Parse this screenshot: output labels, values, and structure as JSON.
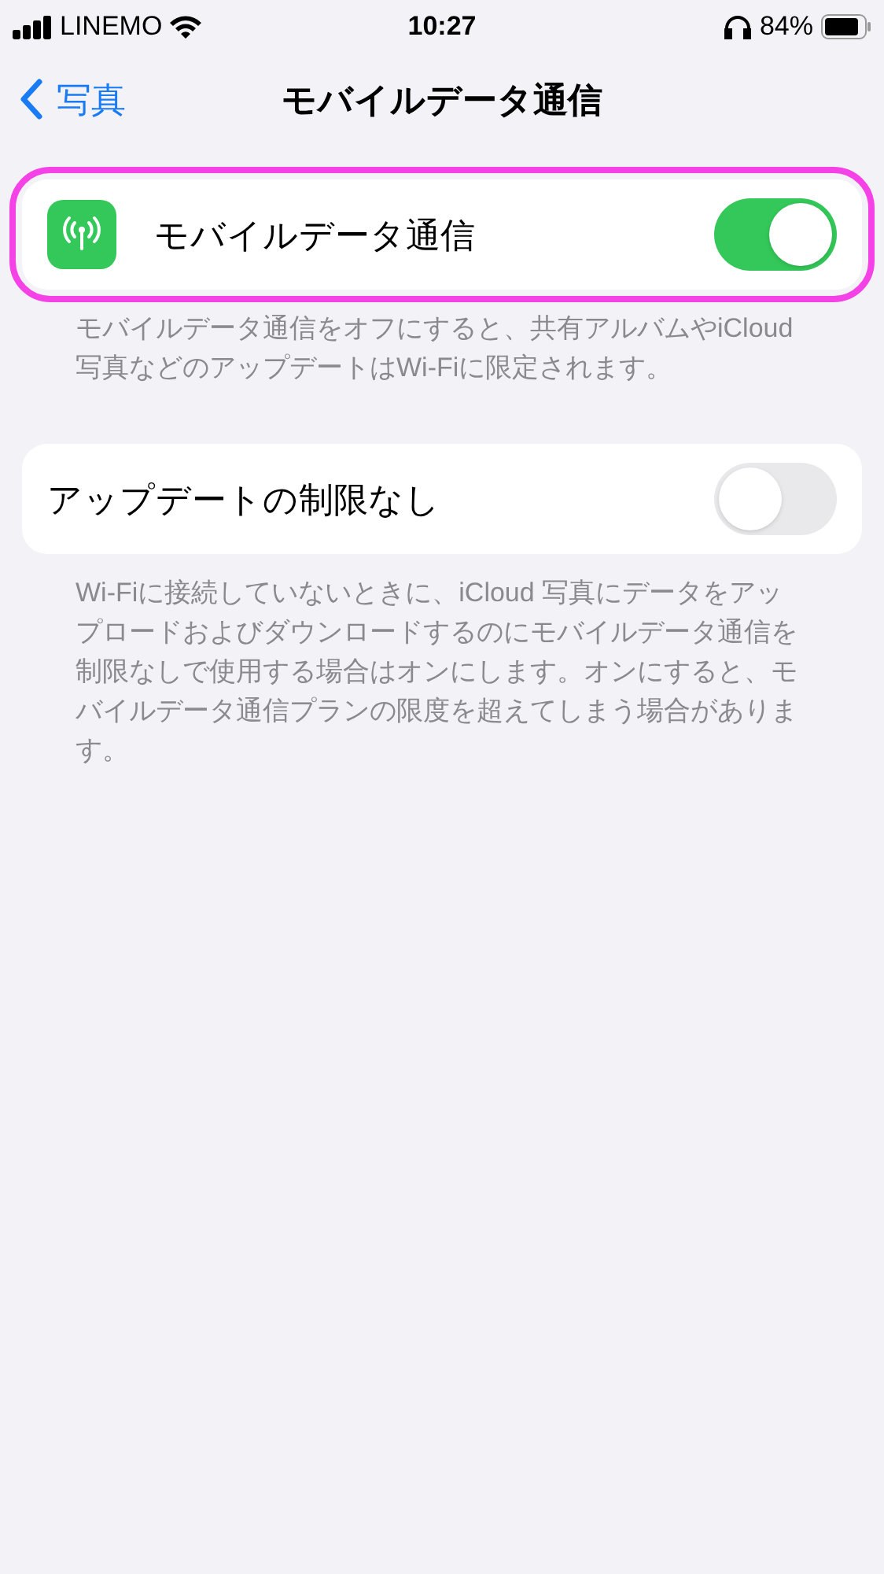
{
  "status_bar": {
    "carrier": "LINEMO",
    "time": "10:27",
    "battery": "84%"
  },
  "nav": {
    "back": "写真",
    "title": "モバイルデータ通信"
  },
  "sections": [
    {
      "highlighted": true,
      "rows": [
        {
          "kind": "icon-toggle",
          "label": "モバイルデータ通信",
          "on": true
        }
      ],
      "footer": "モバイルデータ通信をオフにすると、共有アルバムやiCloud 写真などのアップデートはWi-Fiに限定されます。"
    },
    {
      "highlighted": false,
      "rows": [
        {
          "kind": "toggle",
          "label": "アップデートの制限なし",
          "on": false
        }
      ],
      "footer": "Wi-Fiに接続していないときに、iCloud 写真にデータをアップロードおよびダウンロードするのにモバイルデータ通信を制限なしで使用する場合はオンにします。オンにすると、モバイルデータ通信プランの限度を超えてしまう場合があります。"
    }
  ]
}
